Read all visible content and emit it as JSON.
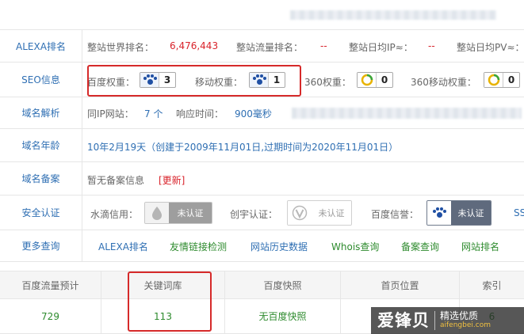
{
  "alexa": {
    "label": "ALEXA排名",
    "world_rank_label": "整站世界排名：",
    "world_rank_value": "6,476,443",
    "traffic_rank_label": "整站流量排名：",
    "traffic_rank_value": "--",
    "daily_ip_label": "整站日均IP≈：",
    "daily_ip_value": "--",
    "daily_pv_label": "整站日均PV≈："
  },
  "seo": {
    "label": "SEO信息",
    "baidu_weight_label": "百度权重：",
    "baidu_weight_value": "3",
    "mobile_weight_label": "移动权重：",
    "mobile_weight_value": "1",
    "s360_weight_label": "360权重：",
    "s360_weight_value": "0",
    "s360_mobile_weight_label": "360移动权重：",
    "s360_mobile_weight_value": "0"
  },
  "dns": {
    "label": "域名解析",
    "same_ip_label": "同IP网站：",
    "same_ip_value": "7 个",
    "response_label": "响应时间：",
    "response_value": "900毫秒"
  },
  "age": {
    "label": "域名年龄",
    "value": "10年2月19天（创建于2009年11月01日,过期时间为2020年11月01日）"
  },
  "icp": {
    "label": "域名备案",
    "value": "暂无备案信息",
    "refresh": "[更新]"
  },
  "security": {
    "label": "安全认证",
    "shuidi_label": "水滴信用：",
    "shuidi_badge": "未认证",
    "chuangyu_label": "创宇认证：",
    "chuangyu_badge": "未认证",
    "baidu_label": "百度信誉：",
    "baidu_badge": "未认证",
    "trailing": "SS"
  },
  "more": {
    "label": "更多查询",
    "links": [
      "ALEXA排名",
      "友情链接检测",
      "网站历史数据",
      "Whois查询",
      "备案查询",
      "网站排名"
    ]
  },
  "table": {
    "headers": [
      "百度流量预计",
      "关键词库",
      "百度快照",
      "首页位置",
      "索引"
    ],
    "values": [
      "729",
      "113",
      "无百度快照",
      "",
      "6"
    ]
  },
  "watermark": {
    "main": "爱锋贝",
    "sub1": "精选优质",
    "sub2": "aifengbei.com"
  },
  "colors": {
    "label_blue": "#2f6fb3",
    "value_red": "#d9232b",
    "value_green": "#2e8b2e",
    "highlight_box": "#d62a2a"
  }
}
